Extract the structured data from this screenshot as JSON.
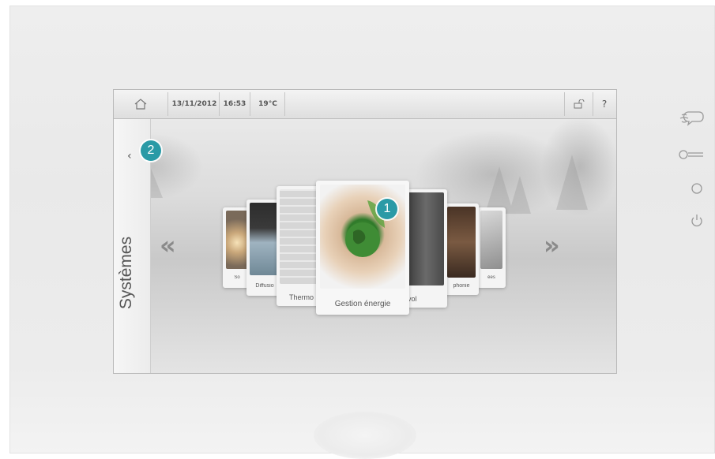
{
  "topbar": {
    "date": "13/11/2012",
    "time": "16:53",
    "temperature": "19°C",
    "help_label": "?"
  },
  "sidebar": {
    "title": "Systèmes",
    "back_label": "‹"
  },
  "carousel": {
    "prev_label": "«",
    "next_label": "»",
    "cards": [
      {
        "label": "So"
      },
      {
        "label": "Diffusio"
      },
      {
        "label": "Thermo"
      },
      {
        "label": "Gestion énergie"
      },
      {
        "label": "vol"
      },
      {
        "label": "phonie"
      },
      {
        "label": "ées"
      }
    ]
  },
  "badges": {
    "badge_1": "1",
    "badge_2": "2"
  },
  "icons": {
    "home": "home-icon",
    "lock": "lock-icon",
    "speech": "speech-icon",
    "key": "key-icon",
    "circle": "circle-button-icon",
    "power": "power-icon"
  },
  "colors": {
    "badge": "#2a9aa6",
    "device": "#ececec"
  }
}
